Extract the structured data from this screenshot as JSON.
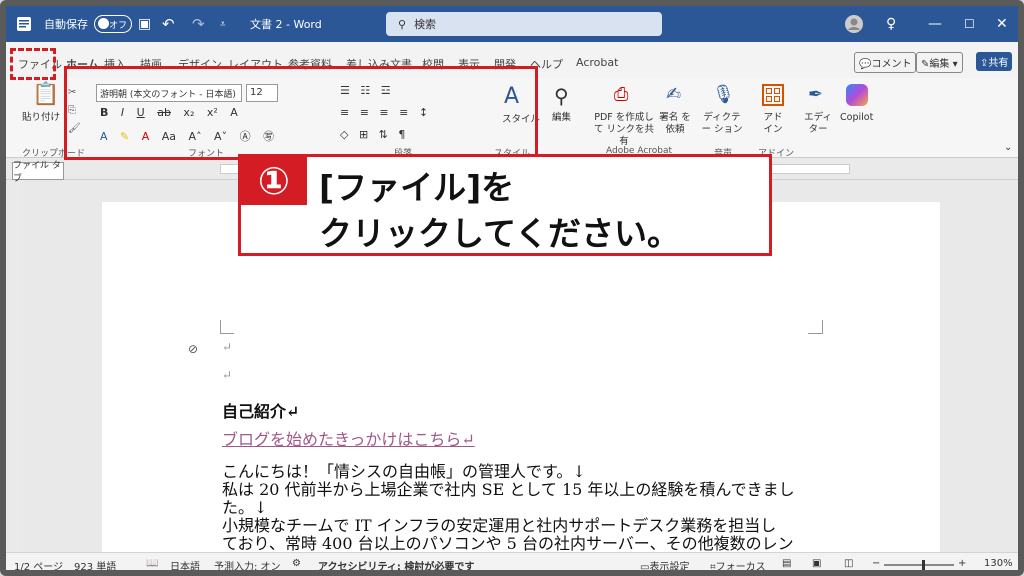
{
  "titlebar": {
    "autosave": "自動保存",
    "toggle": "オフ",
    "doc_title": "文書 2  -  Word",
    "search": "検索"
  },
  "tabs": [
    "ファイル",
    "ホーム",
    "挿入",
    "描画",
    "デザイン",
    "レイアウト",
    "参考資料",
    "差し込み文書",
    "校閲",
    "表示",
    "開発",
    "ヘルプ",
    "Acrobat"
  ],
  "tabs_right": {
    "comment": "コメント",
    "edit": "編集",
    "share": "共有"
  },
  "ribbon": {
    "paste": "貼り付け",
    "clipboard": "クリップボード",
    "font_name": "游明朝 (本文のフォント - 日本語)",
    "font_size": "12",
    "font_group": "フォント",
    "para_group": "段落",
    "style": "スタイル",
    "style_group": "スタイル",
    "edit": "編集",
    "pdf": "PDF を作成して リンクを共有",
    "sign": "署名 を依頼",
    "acrobat_group": "Adobe Acrobat",
    "dictate": "ディクテー ション",
    "voice_group": "音声",
    "addin": "アド イン",
    "addin_group": "アドイン",
    "editor": "エディ ター",
    "copilot": "Copilot"
  },
  "tooltip": "ファイル タブ",
  "callout": {
    "num": "①",
    "line1": "[ファイル]を",
    "line2": "クリックしてください。"
  },
  "document": {
    "heading": "自己紹介↵",
    "link": "ブログを始めたきっかけはこちら↵",
    "p1": "こんにちは！「情シスの自由帳」の管理人です。↓",
    "p2": "私は 20 代前半から上場企業で社内 SE として 15 年以上の経験を積んできまし",
    "p3": "た。↓",
    "p4": "小規模なチームで IT インフラの安定運用と社内サポートデスク業務を担当し",
    "p5": "ており、常時 400 台以上のパソコンや 5 台の社内サーバー、その他複数のレン"
  },
  "statusbar": {
    "page": "1/2 ページ",
    "words": "923 単語",
    "lang": "日本語",
    "predict": "予測入力: オン",
    "access": "アクセシビリティ: 検討が必要です",
    "display": "表示設定",
    "focus": "フォーカス",
    "zoom": "130%"
  }
}
